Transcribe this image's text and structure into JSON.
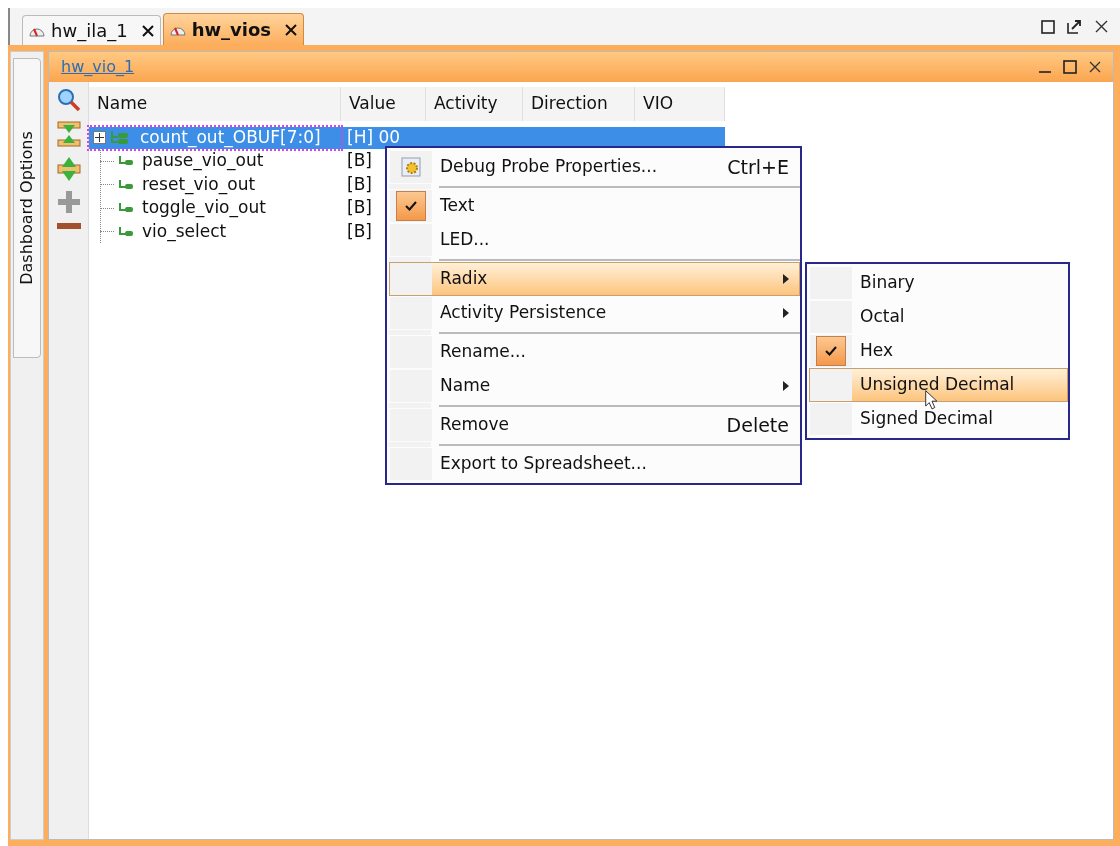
{
  "tabs": [
    {
      "label": "hw_ila_1",
      "selected": false
    },
    {
      "label": "hw_vios",
      "selected": true
    }
  ],
  "side_tab": {
    "label": "Dashboard Options"
  },
  "panel": {
    "title": "hw_vio_1"
  },
  "table": {
    "columns": [
      "Name",
      "Value",
      "Activity",
      "Direction",
      "VIO"
    ],
    "rows": [
      {
        "kind": "bus",
        "expanded": false,
        "selected": true,
        "cells": [
          "count_out_OBUF[7:0]",
          "[H] 00"
        ]
      },
      {
        "kind": "signal",
        "selected": false,
        "cells": [
          "pause_vio_out",
          "[B]"
        ]
      },
      {
        "kind": "signal",
        "selected": false,
        "cells": [
          "reset_vio_out",
          "[B]"
        ]
      },
      {
        "kind": "signal",
        "selected": false,
        "cells": [
          "toggle_vio_out",
          "[B]"
        ]
      },
      {
        "kind": "signal",
        "selected": false,
        "cells": [
          "vio_select",
          "[B]"
        ]
      }
    ]
  },
  "context_menu": {
    "items": [
      {
        "kind": "item",
        "label": "Debug Probe Properties...",
        "shortcut": "Ctrl+E",
        "icon": true,
        "checked": false,
        "selected": false,
        "submenu": false
      },
      {
        "kind": "separator"
      },
      {
        "kind": "item",
        "label": "Text",
        "checked": true,
        "selected": false,
        "submenu": false
      },
      {
        "kind": "item",
        "label": "LED...",
        "checked": false,
        "selected": false,
        "submenu": false
      },
      {
        "kind": "separator"
      },
      {
        "kind": "item",
        "label": "Radix",
        "checked": false,
        "selected": true,
        "submenu": true
      },
      {
        "kind": "item",
        "label": "Activity Persistence",
        "checked": false,
        "selected": false,
        "submenu": true
      },
      {
        "kind": "separator"
      },
      {
        "kind": "item",
        "label": "Rename...",
        "checked": false,
        "selected": false,
        "submenu": false
      },
      {
        "kind": "item",
        "label": "Name",
        "checked": false,
        "selected": false,
        "submenu": true
      },
      {
        "kind": "separator"
      },
      {
        "kind": "item",
        "label": "Remove",
        "shortcut": "Delete",
        "checked": false,
        "selected": false,
        "submenu": false
      },
      {
        "kind": "separator"
      },
      {
        "kind": "item",
        "label": "Export to Spreadsheet...",
        "checked": false,
        "selected": false,
        "submenu": false
      }
    ]
  },
  "radix_submenu": {
    "items": [
      {
        "label": "Binary",
        "checked": false,
        "selected": false
      },
      {
        "label": "Octal",
        "checked": false,
        "selected": false
      },
      {
        "label": "Hex",
        "checked": true,
        "selected": false
      },
      {
        "label": "Unsigned Decimal",
        "checked": false,
        "selected": true
      },
      {
        "label": "Signed Decimal",
        "checked": false,
        "selected": false
      }
    ]
  }
}
